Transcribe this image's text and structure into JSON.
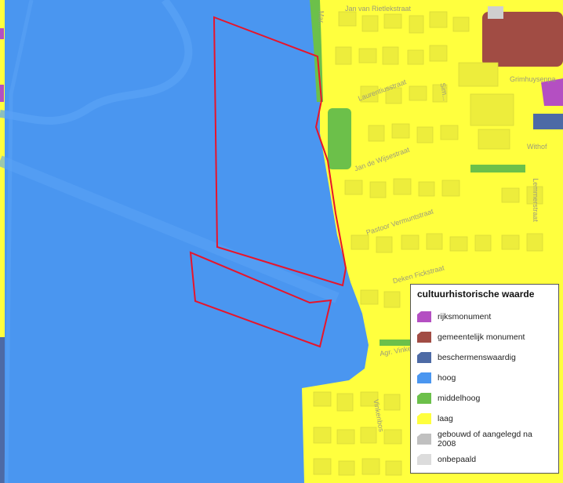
{
  "legend": {
    "title": "cultuurhistorische waarde",
    "items": [
      {
        "label": "rijksmonument",
        "color": "#b44fc2",
        "icon": "purple-swatch-icon"
      },
      {
        "label": "gemeentelijk monument",
        "color": "#a14c44",
        "icon": "brown-swatch-icon"
      },
      {
        "label": "beschermenswaardig",
        "color": "#4d6aa5",
        "icon": "dark-blue-swatch-icon"
      },
      {
        "label": "hoog",
        "color": "#4a96f0",
        "icon": "blue-swatch-icon"
      },
      {
        "label": "middelhoog",
        "color": "#6cc04a",
        "icon": "green-swatch-icon"
      },
      {
        "label": "laag",
        "color": "#ffff3e",
        "icon": "yellow-swatch-icon"
      },
      {
        "label": "gebouwd of aangelegd na 2008",
        "color": "#c0c0c0",
        "icon": "grey-swatch-icon"
      },
      {
        "label": "onbepaald",
        "color": "#dcdcdc",
        "icon": "light-grey-swatch-icon"
      }
    ]
  },
  "streets": {
    "jan_van_riet": "Jan van Rietlekstraat",
    "laurentius": "Laurentiusstraat",
    "jan_de_wijse": "Jan de Wijsestraat",
    "pastoor": "Pastoor Vermuntstraat",
    "deken": "Deken Fickstraat",
    "grimhuysen": "Grimhuysenpa",
    "withof": "Withof",
    "sim": "Sim...",
    "lemm": "Lemmerstraat",
    "agr": "Agr. Vinke...",
    "vinkenbos": "Vinkenbos",
    "mar": "Mar..."
  },
  "colors": {
    "hoog": "#4a96f0",
    "laag": "#ffff3e",
    "middelhoog": "#6cc04a",
    "boundary": "#e8142a"
  }
}
